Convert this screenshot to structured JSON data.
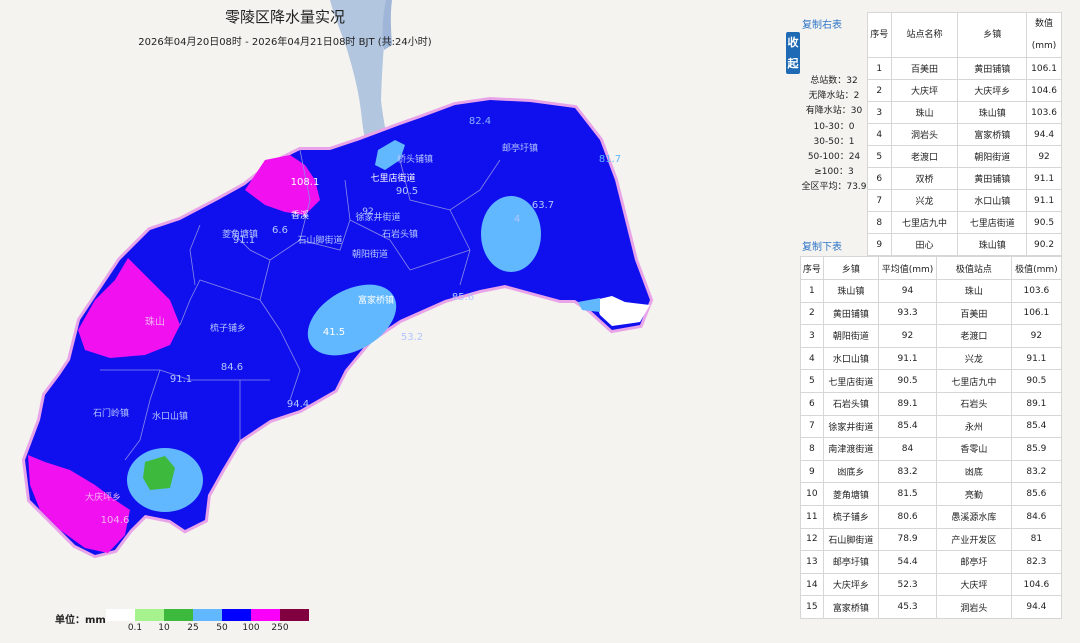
{
  "title": "零陵区降水量实况",
  "subtitle": "2026年04月20日08时 - 2026年04月21日08时 BJT (共:24小时)",
  "map": {
    "labels": [
      "82.4",
      "桥头铺镇",
      "七里店街道",
      "90.5",
      "邮亭圩镇",
      "92",
      "徐家井街道",
      "石山脚街道",
      "81.7",
      "63.7",
      "4",
      "108.1",
      "91.1",
      "6.6",
      "朝阳街道",
      "石岩头镇",
      "85.6",
      "41.5",
      "富家桥镇",
      "53.2",
      "菱角塘镇",
      "84.6",
      "91.1",
      "梳子铺乡",
      "94.4",
      "石门岭镇",
      "水口山镇",
      "大庆坪乡",
      "104.6",
      "珠山",
      "香溪"
    ]
  },
  "legend": {
    "unit_label": "单位：mm",
    "colors": [
      "#ffffff",
      "#a6f28f",
      "#3dba3d",
      "#61b8ff",
      "#0000ff",
      "#fa00fa",
      "#800040"
    ],
    "ticks": [
      "0.1",
      "10",
      "25",
      "50",
      "100",
      "250"
    ]
  },
  "fold_button": {
    "line1": "收",
    "line2": "起"
  },
  "copy_right_label": "复制右表",
  "copy_bottom_label": "复制下表",
  "stats": {
    "total": "总站数：32",
    "no_rain": "无降水站：2",
    "rain": "有降水站：30",
    "r10_30": "10-30：0",
    "r30_50": "30-50：1",
    "r50_100": "50-100：24",
    "r100": "≥100：3",
    "avg": "全区平均：73.9"
  },
  "right_table": {
    "headers": {
      "no": "序号",
      "station": "站点名称",
      "town": "乡镇",
      "value": "数值",
      "unit": "(mm)"
    },
    "rows": [
      {
        "no": "1",
        "station": "百美田",
        "town": "黄田铺镇",
        "value": "106.1"
      },
      {
        "no": "2",
        "station": "大庆坪",
        "town": "大庆坪乡",
        "value": "104.6"
      },
      {
        "no": "3",
        "station": "珠山",
        "town": "珠山镇",
        "value": "103.6"
      },
      {
        "no": "4",
        "station": "洞岩头",
        "town": "富家桥镇",
        "value": "94.4"
      },
      {
        "no": "5",
        "station": "老渡口",
        "town": "朝阳街道",
        "value": "92"
      },
      {
        "no": "6",
        "station": "双桥",
        "town": "黄田铺镇",
        "value": "91.1"
      },
      {
        "no": "7",
        "station": "兴龙",
        "town": "水口山镇",
        "value": "91.1"
      },
      {
        "no": "8",
        "station": "七里店九中",
        "town": "七里店街道",
        "value": "90.5"
      },
      {
        "no": "9",
        "station": "田心",
        "town": "珠山镇",
        "value": "90.2"
      }
    ]
  },
  "bottom_table": {
    "headers": {
      "no": "序号",
      "town": "乡镇",
      "avg": "平均值(mm)",
      "station": "极值站点",
      "max": "极值(mm)"
    },
    "rows": [
      {
        "no": "1",
        "town": "珠山镇",
        "avg": "94",
        "station": "珠山",
        "max": "103.6"
      },
      {
        "no": "2",
        "town": "黄田铺镇",
        "avg": "93.3",
        "station": "百美田",
        "max": "106.1"
      },
      {
        "no": "3",
        "town": "朝阳街道",
        "avg": "92",
        "station": "老渡口",
        "max": "92"
      },
      {
        "no": "4",
        "town": "水口山镇",
        "avg": "91.1",
        "station": "兴龙",
        "max": "91.1"
      },
      {
        "no": "5",
        "town": "七里店街道",
        "avg": "90.5",
        "station": "七里店九中",
        "max": "90.5"
      },
      {
        "no": "6",
        "town": "石岩头镇",
        "avg": "89.1",
        "station": "石岩头",
        "max": "89.1"
      },
      {
        "no": "7",
        "town": "徐家井街道",
        "avg": "85.4",
        "station": "永州",
        "max": "85.4"
      },
      {
        "no": "8",
        "town": "南津渡街道",
        "avg": "84",
        "station": "香零山",
        "max": "85.9"
      },
      {
        "no": "9",
        "town": "凼底乡",
        "avg": "83.2",
        "station": "凼底",
        "max": "83.2"
      },
      {
        "no": "10",
        "town": "菱角塘镇",
        "avg": "81.5",
        "station": "亮勤",
        "max": "85.6"
      },
      {
        "no": "11",
        "town": "梳子铺乡",
        "avg": "80.6",
        "station": "愚溪源水库",
        "max": "84.6"
      },
      {
        "no": "12",
        "town": "石山脚街道",
        "avg": "78.9",
        "station": "产业开发区",
        "max": "81"
      },
      {
        "no": "13",
        "town": "邮亭圩镇",
        "avg": "54.4",
        "station": "邮亭圩",
        "max": "82.3"
      },
      {
        "no": "14",
        "town": "大庆坪乡",
        "avg": "52.3",
        "station": "大庆坪",
        "max": "104.6"
      },
      {
        "no": "15",
        "town": "富家桥镇",
        "avg": "45.3",
        "station": "洞岩头",
        "max": "94.4"
      }
    ]
  }
}
